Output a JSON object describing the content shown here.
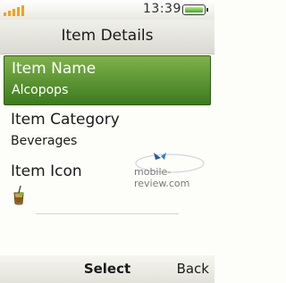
{
  "status_bar": {
    "time": "13:39",
    "signal_icon": "signal-bars-icon",
    "battery_icon": "battery-icon"
  },
  "header": {
    "title": "Item Details"
  },
  "items": [
    {
      "label": "Item Name",
      "value": "Alcopops"
    },
    {
      "label": "Item Category",
      "value": "Beverages"
    },
    {
      "label": "Item Icon",
      "icon": "drink-icon"
    }
  ],
  "watermark": {
    "text": "mobile-review.com"
  },
  "softkeys": {
    "center": "Select",
    "right": "Back"
  },
  "colors": {
    "selection": "#5a9a33",
    "signal": "#f4a21a",
    "battery": "#3ea82a"
  }
}
